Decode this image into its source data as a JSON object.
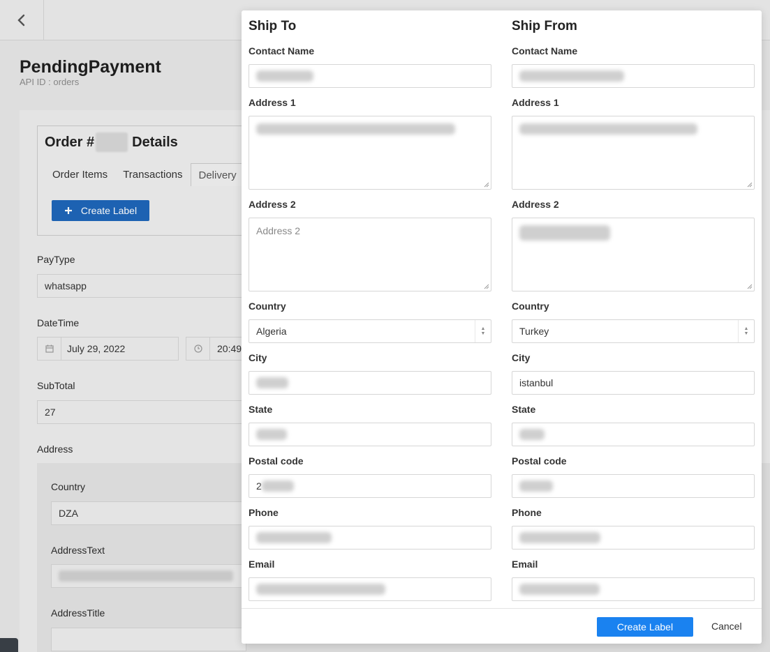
{
  "page": {
    "title": "PendingPayment",
    "subtitle": "API ID : orders"
  },
  "order": {
    "title_prefix": "Order #",
    "title_suffix": "Details",
    "tabs": [
      "Order Items",
      "Transactions",
      "Delivery"
    ],
    "create_label_button": "Create Label"
  },
  "form": {
    "paytype_label": "PayType",
    "paytype_value": "whatsapp",
    "datetime_label": "DateTime",
    "date_value": "July 29, 2022",
    "time_value": "20:49",
    "subtotal_label": "SubTotal",
    "subtotal_value": "27",
    "address_label": "Address",
    "country_label": "Country",
    "country_value": "DZA",
    "addresstext_label": "AddressText",
    "addresstitle_label": "AddressTitle"
  },
  "modal": {
    "ship_to": {
      "title": "Ship To",
      "contact_name_label": "Contact Name",
      "address1_label": "Address 1",
      "address2_label": "Address 2",
      "address2_placeholder": "Address 2",
      "country_label": "Country",
      "country_value": "Algeria",
      "city_label": "City",
      "state_label": "State",
      "postal_label": "Postal code",
      "postal_partial": "2",
      "phone_label": "Phone",
      "email_label": "Email"
    },
    "ship_from": {
      "title": "Ship From",
      "contact_name_label": "Contact Name",
      "address1_label": "Address 1",
      "address2_label": "Address 2",
      "country_label": "Country",
      "country_value": "Turkey",
      "city_label": "City",
      "city_value": "istanbul",
      "state_label": "State",
      "postal_label": "Postal code",
      "phone_label": "Phone",
      "email_label": "Email"
    },
    "create_button": "Create Label",
    "cancel_button": "Cancel"
  },
  "colors": {
    "primary": "#1a82f0",
    "secondary_primary": "#1e66b8"
  }
}
